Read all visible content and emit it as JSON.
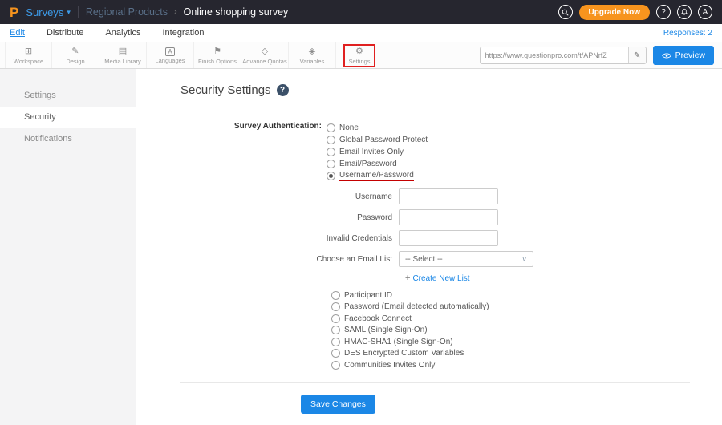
{
  "topbar": {
    "logo_letter": "P",
    "product_label": "Surveys",
    "breadcrumb": {
      "parent": "Regional Products",
      "separator": "›",
      "current": "Online shopping survey"
    },
    "upgrade_label": "Upgrade Now",
    "help_glyph": "?",
    "avatar_letter": "A"
  },
  "menubar": {
    "tabs": [
      {
        "label": "Edit",
        "active": true
      },
      {
        "label": "Distribute",
        "active": false
      },
      {
        "label": "Analytics",
        "active": false
      },
      {
        "label": "Integration",
        "active": false
      }
    ],
    "responses_label": "Responses: 2"
  },
  "toolbar": {
    "items": [
      {
        "label": "Workspace",
        "glyph": "⊞"
      },
      {
        "label": "Design",
        "glyph": "✎"
      },
      {
        "label": "Media Library",
        "glyph": "▤"
      },
      {
        "label": "Languages",
        "glyph": "A"
      },
      {
        "label": "Finish Options",
        "glyph": "⚑"
      },
      {
        "label": "Advance Quotas",
        "glyph": "◇"
      },
      {
        "label": "Variables",
        "glyph": "◈"
      },
      {
        "label": "Settings",
        "glyph": "⚙",
        "highlighted": true
      }
    ],
    "url": "https://www.questionpro.com/t/APNrfZ",
    "preview_label": "Preview"
  },
  "sidebar": {
    "items": [
      {
        "label": "Settings",
        "active": false
      },
      {
        "label": "Security",
        "active": true
      },
      {
        "label": "Notifications",
        "active": false
      }
    ]
  },
  "main": {
    "title": "Security Settings",
    "help_glyph": "?",
    "auth_label": "Survey Authentication:",
    "options_top": [
      "None",
      "Global Password Protect",
      "Email Invites Only",
      "Email/Password",
      "Username/Password"
    ],
    "selected_option": "Username/Password",
    "fields": [
      {
        "label": "Username",
        "value": ""
      },
      {
        "label": "Password",
        "value": ""
      },
      {
        "label": "Invalid Credentials",
        "value": ""
      }
    ],
    "email_list_label": "Choose an Email List",
    "email_list_value": "-- Select --",
    "create_list_label": "Create New List",
    "options_bottom": [
      "Participant ID",
      "Password (Email detected automatically)",
      "Facebook Connect",
      "SAML (Single Sign-On)",
      "HMAC-SHA1 (Single Sign-On)",
      "DES Encrypted Custom Variables",
      "Communities Invites Only"
    ],
    "save_label": "Save Changes"
  },
  "icons": {
    "caret_down": "▾",
    "chevron_down": "∨",
    "plus": "+",
    "pencil": "✎"
  },
  "colors": {
    "accent_blue": "#1b87e6",
    "brand_orange": "#f7941e",
    "annotation_red": "#e02020",
    "topbar_bg": "#26262f"
  }
}
